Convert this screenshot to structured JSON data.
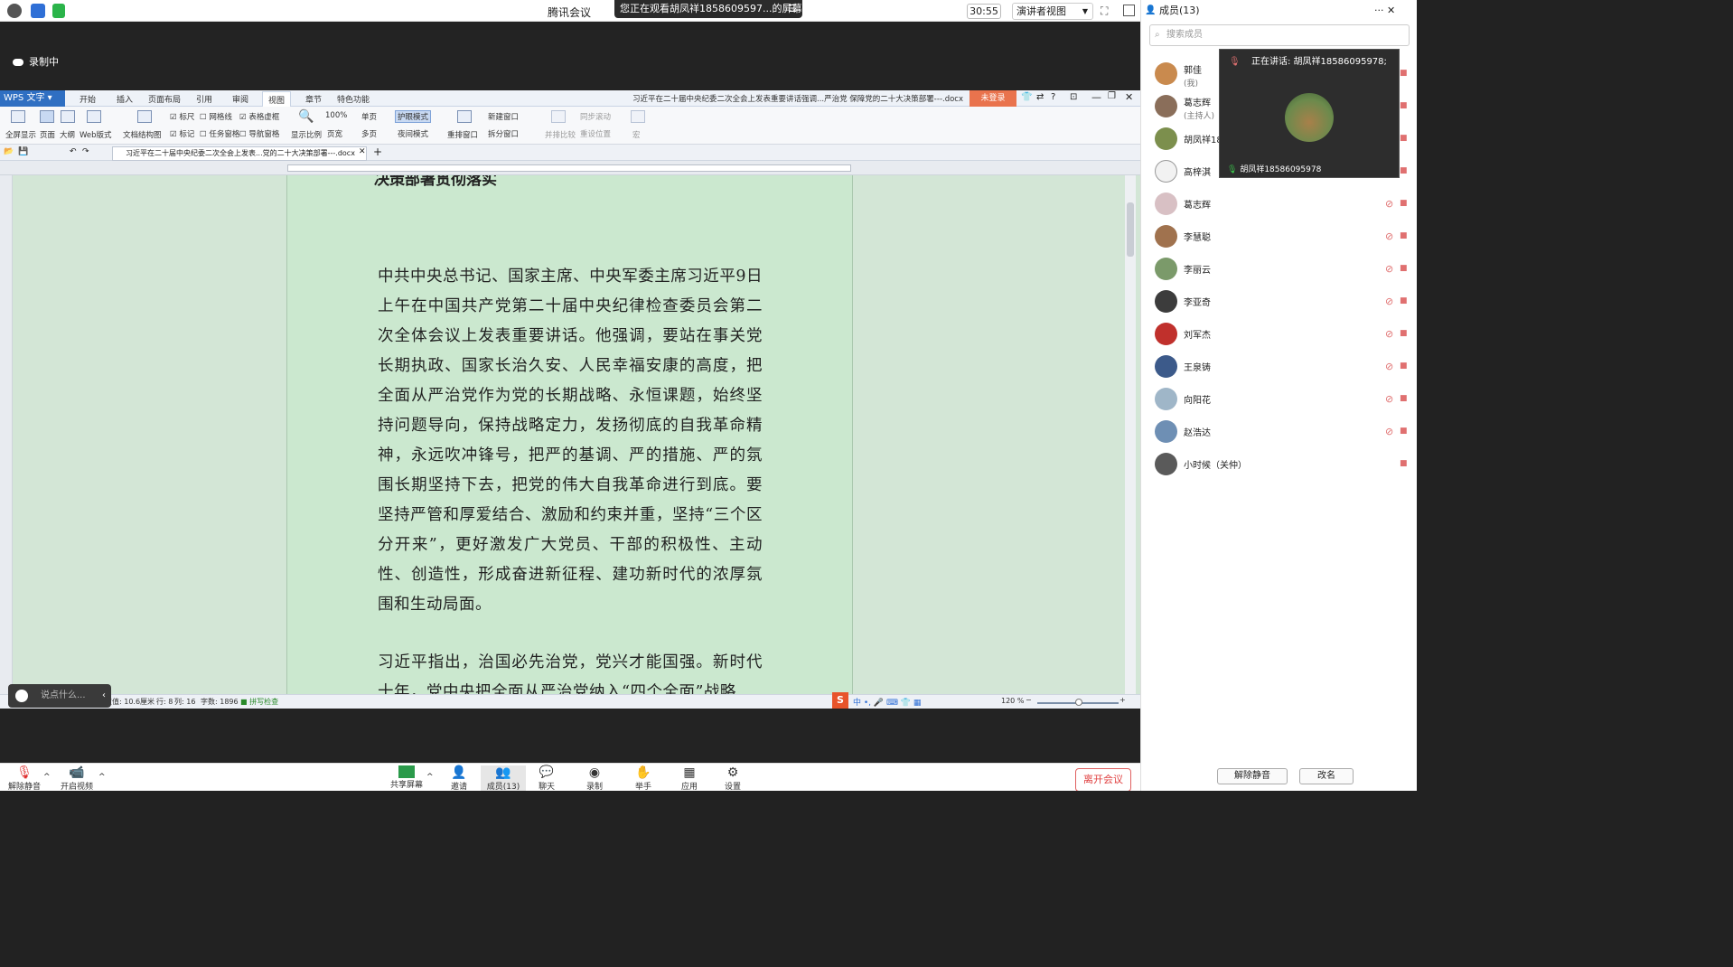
{
  "topbar": {
    "title": "腾讯会议",
    "share_banner": "您正在观看胡凤祥1858609597...的屏幕",
    "timer": "30:55",
    "view_mode": "演讲者视图"
  },
  "stage": {
    "recording_label": "录制中"
  },
  "wps": {
    "app_name": "WPS 文字",
    "menu_tabs": [
      "开始",
      "插入",
      "页面布局",
      "引用",
      "审阅",
      "视图",
      "章节",
      "特色功能"
    ],
    "active_tab": "视图",
    "doc_title": "习近平在二十届中央纪委二次全会上发表重要讲话强调...严治党 保障党的二十大决策部署---.docx",
    "login_label": "未登录",
    "ribbon": {
      "fullscreen": "全屏显示",
      "page": "页面",
      "outline": "大纲",
      "web": "Web版式",
      "doc_structure": "文档结构图",
      "ruler": "标尺",
      "gridlines": "网格线",
      "table_virtual": "表格虚框",
      "mark": "标记",
      "task_pane": "任务窗格",
      "nav_pane": "导航窗格",
      "zoom_ratio": "显示比例",
      "zoom_100": "100%",
      "single_page": "单页",
      "page_width": "页宽",
      "multi_page": "多页",
      "eye_mode": "护眼模式",
      "night_mode": "夜间模式",
      "rearrange": "重排窗口",
      "new_window": "新建窗口",
      "split_window": "拆分窗口",
      "side_by_side": "并排比较",
      "sync_scroll": "同步滚动",
      "reset_pos": "重设位置",
      "macro": "宏"
    },
    "doc_tab": "习近平在二十届中央纪委二次全会上发表...党的二十大决策部署---.docx",
    "heading_fragment": "决策部署贯彻落实",
    "paragraphs": [
      "中共中央总书记、国家主席、中央军委主席习近平9日上午在中国共产党第二十届中央纪律检查委员会第二次全体会议上发表重要讲话。他强调，要站在事关党长期执政、国家长治久安、人民幸福安康的高度，把全面从严治党作为党的长期战略、永恒课题，始终坚持问题导向，保持战略定力，发扬彻底的自我革命精神，永远吹冲锋号，把严的基调、严的措施、严的氛围长期坚持下去，把党的伟大自我革命进行到底。要坚持严管和厚爱结合、激励和约束并重，坚持“三个区分开来”，更好激发广大党员、干部的积极性、主动性、创造性，形成奋进新征程、建功新时代的浓厚氛围和生动局面。",
      "习近平指出，治国必先治党，党兴才能国强。新时代十年，党中央把全面从严治党纳入“四个全面”战略"
    ],
    "status": {
      "position": "设置值: 10.6厘米",
      "line": "行: 8",
      "col": "列: 16",
      "words": "字数: 1896",
      "spell": "拼写检查",
      "zoom": "120 %"
    }
  },
  "chat": {
    "placeholder": "说点什么..."
  },
  "bottombar": {
    "unmute": "解除静音",
    "start_video": "开启视频",
    "share_screen": "共享屏幕",
    "invite": "邀请",
    "members": "成员(13)",
    "chat": "聊天",
    "record": "录制",
    "raise_hand": "举手",
    "apps": "应用",
    "settings": "设置",
    "leave": "离开会议"
  },
  "panel": {
    "header": "成员(13)",
    "search_placeholder": "搜索成员",
    "speaker_label": "正在讲话: 胡凤祥18586095978;",
    "speaker_name": "胡凤祥18586095978",
    "members": [
      {
        "name": "郭佳",
        "sub": "(我)",
        "color": "#c98a4e"
      },
      {
        "name": "葛志辉",
        "sub": "(主持人)",
        "color": "#8a6e5a"
      },
      {
        "name": "胡凤祥18",
        "sub": "",
        "color": "#7c8f4d"
      },
      {
        "name": "高梓淇",
        "sub": "",
        "color": "#f2f2f2"
      },
      {
        "name": "葛志辉",
        "sub": "",
        "color": "#d8c0c4"
      },
      {
        "name": "李慧聪",
        "sub": "",
        "color": "#a0724e"
      },
      {
        "name": "李丽云",
        "sub": "",
        "color": "#7b9a6a"
      },
      {
        "name": "李亚奇",
        "sub": "",
        "color": "#3c3c3c"
      },
      {
        "name": "刘军杰",
        "sub": "",
        "color": "#c0302c"
      },
      {
        "name": "王泉铸",
        "sub": "",
        "color": "#3c5a8a"
      },
      {
        "name": "向阳花",
        "sub": "",
        "color": "#9fb6c8"
      },
      {
        "name": "赵浩达",
        "sub": "",
        "color": "#6e8fb4"
      },
      {
        "name": "小时候（关仲）",
        "sub": "",
        "color": "#5a5a5a"
      }
    ],
    "unmute_all": "解除静音",
    "rename": "改名"
  }
}
